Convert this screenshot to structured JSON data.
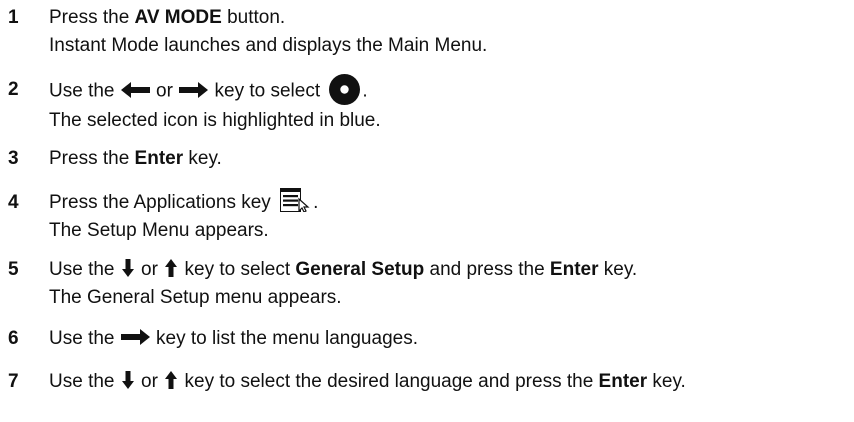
{
  "steps": [
    {
      "number": "1",
      "line1": {
        "a": "Press the ",
        "b": "AV MODE",
        "c": " button."
      },
      "line2": "Instant Mode launches and displays the Main Menu."
    },
    {
      "number": "2",
      "line1": {
        "a": "Use the ",
        "b": " or ",
        "c": " key to select ",
        "d": "."
      },
      "line2": "The selected icon is highlighted in blue."
    },
    {
      "number": "3",
      "line1": {
        "a": "Press the ",
        "b": "Enter",
        "c": " key."
      }
    },
    {
      "number": "4",
      "line1": {
        "a": "Press the Applications key ",
        "b": "."
      },
      "line2": "The Setup Menu appears."
    },
    {
      "number": "5",
      "line1": {
        "a": "Use the ",
        "b": " or ",
        "c": " key to select ",
        "d": "General Setup",
        "e": " and press the ",
        "f": "Enter",
        "g": " key."
      },
      "line2": "The General Setup menu appears."
    },
    {
      "number": "6",
      "line1": {
        "a": "Use the ",
        "b": " key to list the menu languages."
      }
    },
    {
      "number": "7",
      "line1": {
        "a": "Use the ",
        "b": " or ",
        "c": " key to select the desired language and press the ",
        "d": "Enter",
        "e": " key."
      }
    }
  ],
  "icons": {
    "left_arrow": "left-arrow-icon",
    "right_arrow": "right-arrow-icon",
    "down_arrow": "down-arrow-icon",
    "up_arrow": "up-arrow-icon",
    "disc": "disc-icon",
    "applications_key": "applications-key-icon"
  }
}
